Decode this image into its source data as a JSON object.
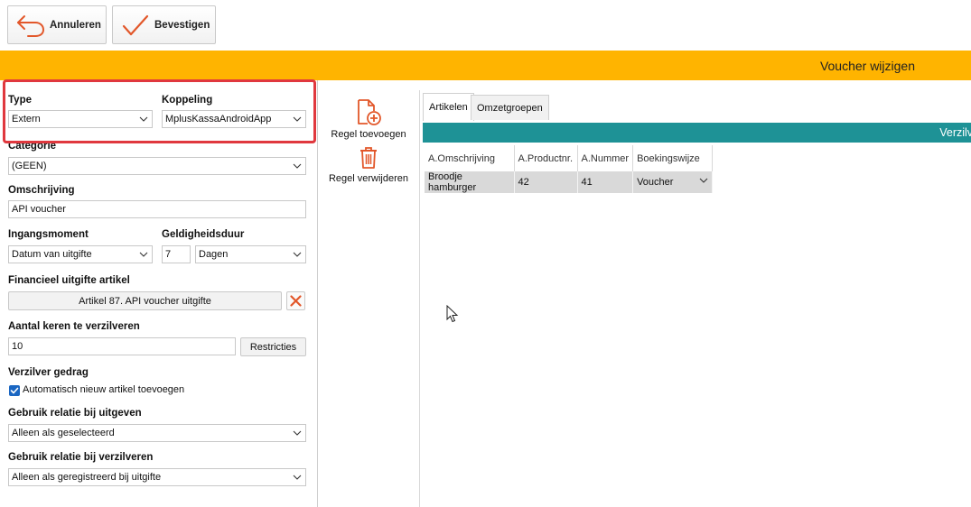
{
  "toolbar": {
    "cancel_label": "Annuleren",
    "confirm_label": "Bevestigen"
  },
  "banner": {
    "title": "Voucher wijzigen"
  },
  "form": {
    "type_label": "Type",
    "type_value": "Extern",
    "koppeling_label": "Koppeling",
    "koppeling_value": "MplusKassaAndroidApp",
    "categorie_label": "Categorie",
    "categorie_value": "(GEEN)",
    "omschrijving_label": "Omschrijving",
    "omschrijving_value": "API voucher",
    "ingangsmoment_label": "Ingangsmoment",
    "ingangsmoment_value": "Datum van uitgifte",
    "geldigheidsduur_label": "Geldigheidsduur",
    "geldigheidsduur_value": "7",
    "geldigheidsduur_unit": "Dagen",
    "financieel_label": "Financieel uitgifte artikel",
    "financieel_value": "Artikel 87. API voucher uitgifte",
    "aantal_label": "Aantal keren te verzilveren",
    "aantal_value": "10",
    "restricties_label": "Restricties",
    "verzilver_label": "Verzilver gedrag",
    "auto_checkbox_label": "Automatisch nieuw artikel toevoegen",
    "auto_checkbox_checked": true,
    "relatie_uitgeven_label": "Gebruik relatie bij uitgeven",
    "relatie_uitgeven_value": "Alleen als geselecteerd",
    "relatie_verzilveren_label": "Gebruik relatie bij verzilveren",
    "relatie_verzilveren_value": "Alleen als geregistreerd bij uitgifte"
  },
  "actions": {
    "add_row_label": "Regel toevoegen",
    "remove_row_label": "Regel verwijderen"
  },
  "tabs": [
    {
      "label": "Artikelen",
      "active": true
    },
    {
      "label": "Omzetgroepen",
      "active": false
    }
  ],
  "grid": {
    "header_bar": "Verzilve",
    "columns": [
      "A.Omschrijving",
      "A.Productnr.",
      "A.Nummer",
      "Boekingswijze"
    ],
    "rows": [
      [
        "Broodje hamburger",
        "42",
        "41",
        "Voucher"
      ]
    ]
  },
  "colors": {
    "banner": "#ffb400",
    "accent_orange": "#e2572a",
    "teal": "#1e9296",
    "highlight_red": "#e0383e"
  }
}
